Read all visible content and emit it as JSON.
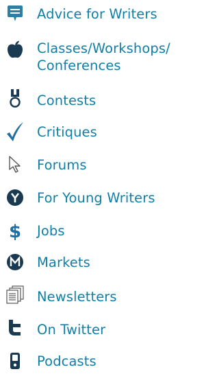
{
  "nav": {
    "items": [
      {
        "label": "Advice for Writers",
        "icon": "speech-bubble-icon"
      },
      {
        "label": "Classes/Workshops/ Conferences",
        "icon": "apple-icon"
      },
      {
        "label": "Contests",
        "icon": "medal-icon"
      },
      {
        "label": "Critiques",
        "icon": "checkmark-icon"
      },
      {
        "label": "Forums",
        "icon": "cursor-arrow-icon"
      },
      {
        "label": "For Young Writers",
        "icon": "letter-y-circle-icon"
      },
      {
        "label": "Jobs",
        "icon": "dollar-icon"
      },
      {
        "label": "Markets",
        "icon": "letter-m-circle-icon"
      },
      {
        "label": "Newsletters",
        "icon": "newspaper-stack-icon"
      },
      {
        "label": "On Twitter",
        "icon": "twitter-t-icon"
      },
      {
        "label": "Podcasts",
        "icon": "audio-player-icon"
      }
    ]
  },
  "colors": {
    "link": "#0e7fa8",
    "icon_primary": "#2d7fa6",
    "icon_dark": "#1a3a52",
    "checkmark": "#1f6fa0",
    "outline": "#555555"
  }
}
